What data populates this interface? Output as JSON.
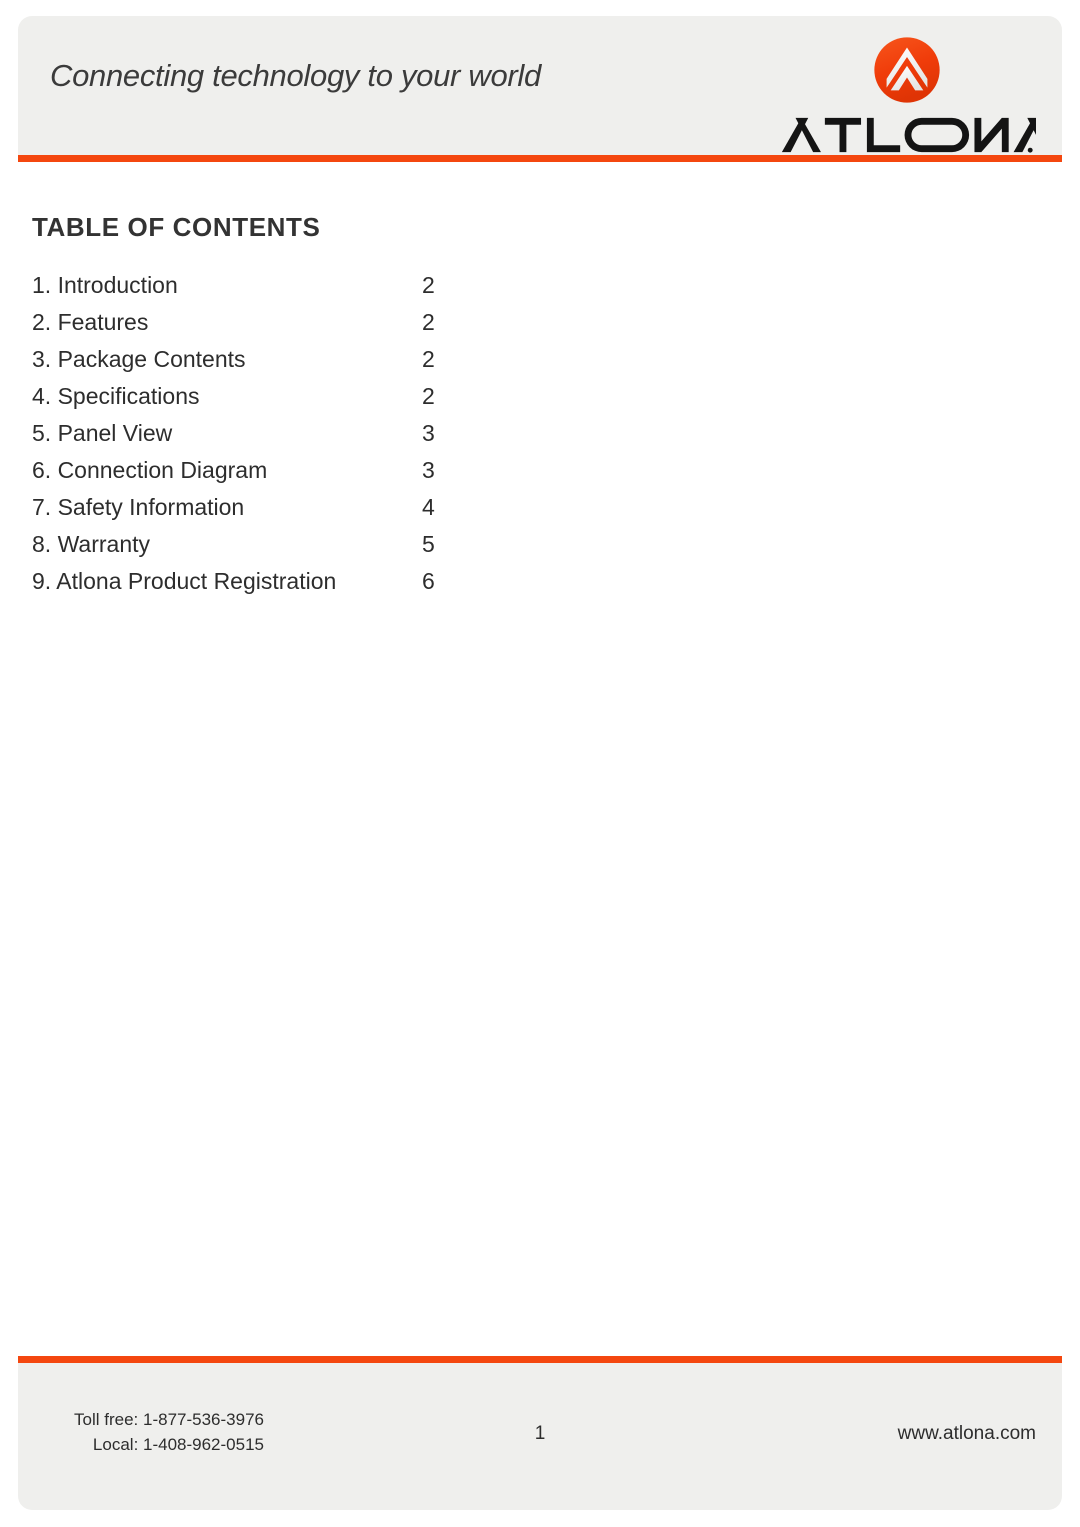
{
  "header": {
    "tagline": "Connecting technology to your world",
    "brand_name": "ATLONA",
    "logo_icon": "atlona-chevron-logo",
    "accent_color": "#f4470f",
    "band_color": "#efefed"
  },
  "document": {
    "toc_heading": "TABLE OF CONTENTS",
    "toc_entries": [
      {
        "label": "1. Introduction",
        "page": "2"
      },
      {
        "label": "2. Features",
        "page": "2"
      },
      {
        "label": "3. Package Contents",
        "page": "2"
      },
      {
        "label": "4. Specifications",
        "page": "2"
      },
      {
        "label": "5. Panel View",
        "page": "3"
      },
      {
        "label": "6. Connection Diagram",
        "page": "3"
      },
      {
        "label": "7. Safety Information",
        "page": "4"
      },
      {
        "label": "8. Warranty",
        "page": "5"
      },
      {
        "label": "9. Atlona Product Registration",
        "page": "6"
      }
    ]
  },
  "footer": {
    "toll_free": "Toll free: 1-877-536-3976",
    "local": "Local: 1-408-962-0515",
    "page_number": "1",
    "website": "www.atlona.com"
  }
}
